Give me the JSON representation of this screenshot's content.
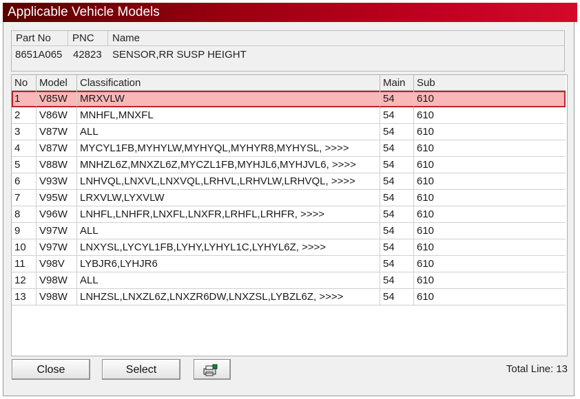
{
  "window": {
    "title": "Applicable Vehicle Models"
  },
  "part": {
    "headers": [
      "Part No",
      "PNC",
      "Name"
    ],
    "part_no": "8651A065",
    "pnc": "42823",
    "name": "SENSOR,RR SUSP HEIGHT"
  },
  "grid": {
    "headers": [
      "No",
      "Model",
      "Classification",
      "Main",
      "Sub"
    ],
    "rows": [
      {
        "no": "1",
        "model": "V85W",
        "classification": "MRXVLW",
        "main": "54",
        "sub": "610"
      },
      {
        "no": "2",
        "model": "V86W",
        "classification": "MNHFL,MNXFL",
        "main": "54",
        "sub": "610"
      },
      {
        "no": "3",
        "model": "V87W",
        "classification": "ALL",
        "main": "54",
        "sub": "610"
      },
      {
        "no": "4",
        "model": "V87W",
        "classification": "MYCYL1FB,MYHYLW,MYHYQL,MYHYR8,MYHYSL,  >>>>",
        "main": "54",
        "sub": "610"
      },
      {
        "no": "5",
        "model": "V88W",
        "classification": "MNHZL6Z,MNXZL6Z,MYCZL1FB,MYHJL6,MYHJVL6,  >>>>",
        "main": "54",
        "sub": "610"
      },
      {
        "no": "6",
        "model": "V93W",
        "classification": "LNHVQL,LNXVL,LNXVQL,LRHVL,LRHVLW,LRHVQL,  >>>>",
        "main": "54",
        "sub": "610"
      },
      {
        "no": "7",
        "model": "V95W",
        "classification": "LRXVLW,LYXVLW",
        "main": "54",
        "sub": "610"
      },
      {
        "no": "8",
        "model": "V96W",
        "classification": "LNHFL,LNHFR,LNXFL,LNXFR,LRHFL,LRHFR,  >>>>",
        "main": "54",
        "sub": "610"
      },
      {
        "no": "9",
        "model": "V97W",
        "classification": "ALL",
        "main": "54",
        "sub": "610"
      },
      {
        "no": "10",
        "model": "V97W",
        "classification": "LNXYSL,LYCYL1FB,LYHY,LYHYL1C,LYHYL6Z,  >>>>",
        "main": "54",
        "sub": "610"
      },
      {
        "no": "11",
        "model": "V98V",
        "classification": "LYBJR6,LYHJR6",
        "main": "54",
        "sub": "610"
      },
      {
        "no": "12",
        "model": "V98W",
        "classification": "ALL",
        "main": "54",
        "sub": "610"
      },
      {
        "no": "13",
        "model": "V98W",
        "classification": "LNHZSL,LNXZL6Z,LNXZR6DW,LNXZSL,LYBZL6Z,  >>>>",
        "main": "54",
        "sub": "610"
      }
    ],
    "selected_row": 1
  },
  "buttons": {
    "close": "Close",
    "select": "Select",
    "print_icon": "printer-icon"
  },
  "footer": {
    "total_label": "Total Line:",
    "total_value": "13"
  },
  "colors": {
    "title_bar_start": "#5a0000",
    "title_bar_end": "#d30a2a",
    "selected_row_fill": "#f9b7b7",
    "selected_row_border": "#c0202a"
  }
}
